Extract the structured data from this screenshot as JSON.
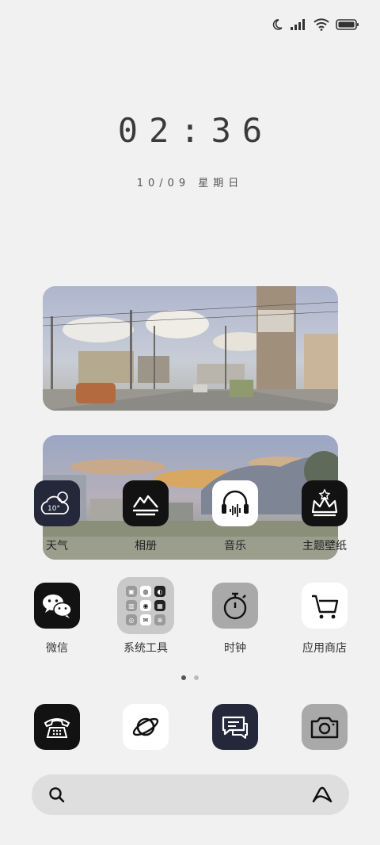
{
  "status_bar": {
    "icons": [
      "moon-icon",
      "signal-icon",
      "wifi-icon",
      "battery-icon"
    ]
  },
  "clock": {
    "time": "02:36",
    "date": "10/09 星期日"
  },
  "widgets": [
    {
      "name": "photo-widget-street"
    },
    {
      "name": "photo-widget-sunset"
    }
  ],
  "apps_row1": [
    {
      "label": "天气",
      "icon": "weather-icon",
      "temp": "10°"
    },
    {
      "label": "相册",
      "icon": "gallery-icon"
    },
    {
      "label": "音乐",
      "icon": "music-icon"
    },
    {
      "label": "主题壁纸",
      "icon": "theme-icon"
    }
  ],
  "apps_row2": [
    {
      "label": "微信",
      "icon": "wechat-icon"
    },
    {
      "label": "系统工具",
      "icon": "folder-icon"
    },
    {
      "label": "时钟",
      "icon": "clock-icon"
    },
    {
      "label": "应用商店",
      "icon": "store-icon"
    }
  ],
  "dock": [
    {
      "icon": "phone-icon"
    },
    {
      "icon": "browser-icon"
    },
    {
      "icon": "messages-icon"
    },
    {
      "icon": "camera-icon"
    }
  ],
  "page_indicator": {
    "pages": 2,
    "current": 1
  },
  "search_bar": {
    "left_icon": "search-icon",
    "right_icon": "assistant-icon"
  },
  "colors": {
    "background": "#f1f1f1",
    "icon_dark": "#121212",
    "folder": "#c9c9c9"
  }
}
